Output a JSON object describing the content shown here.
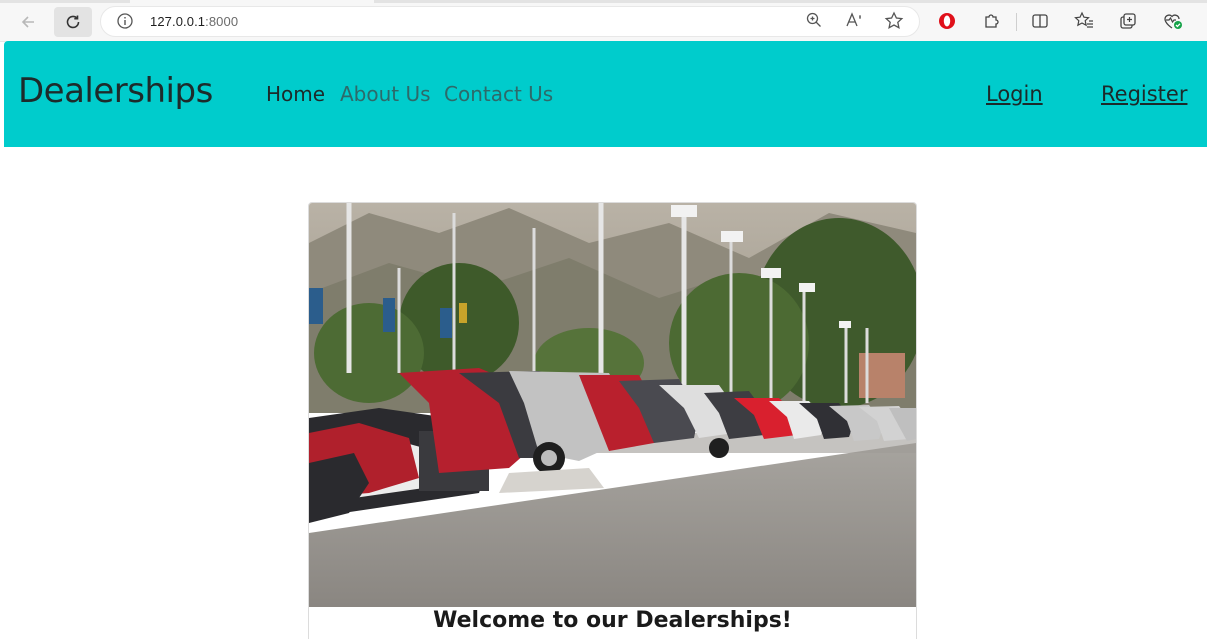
{
  "browser": {
    "url_host": "127.0.0.1",
    "url_port": ":8000"
  },
  "navbar": {
    "brand": "Dealerships",
    "links": [
      "Home",
      "About Us",
      "Contact Us"
    ],
    "login": "Login",
    "register": "Register",
    "background": "#00cccc"
  },
  "card": {
    "image_alt": "dealership-parking-lot-photo",
    "title": "Welcome to our Dealerships!"
  }
}
